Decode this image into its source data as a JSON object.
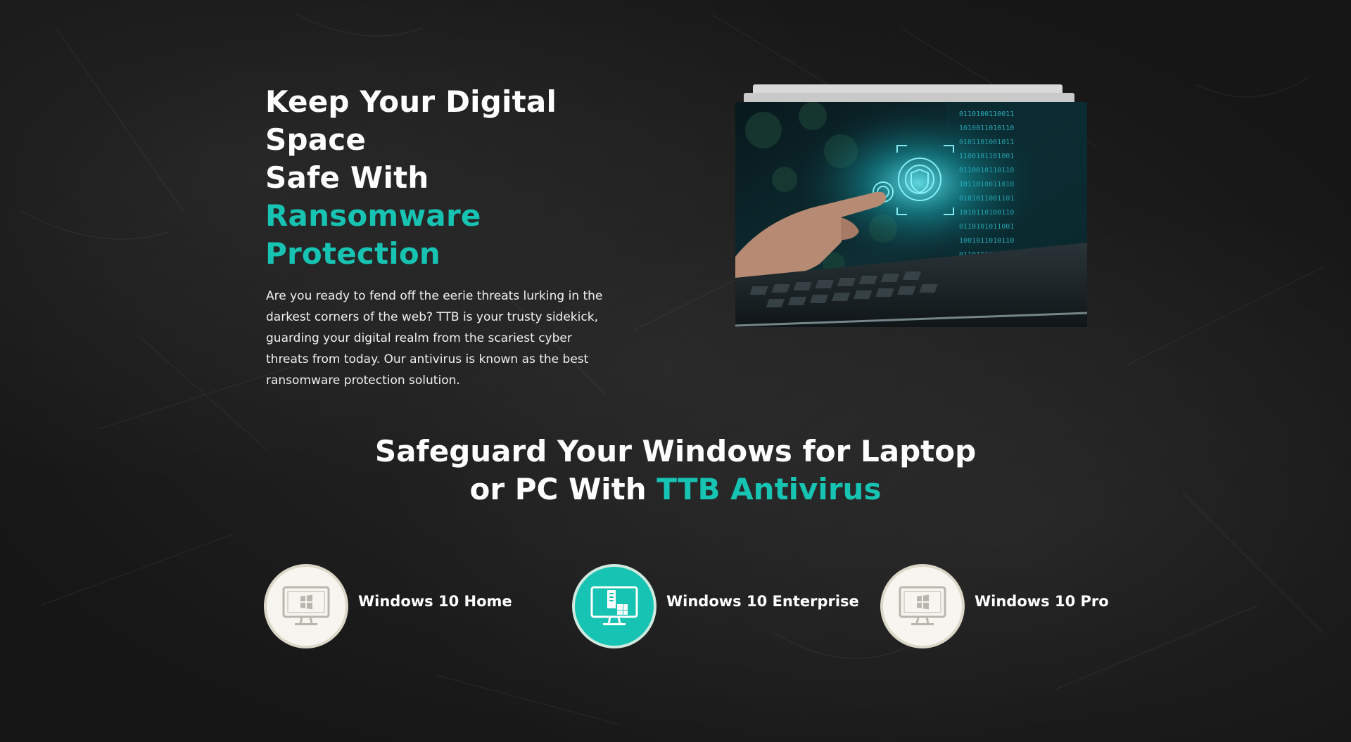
{
  "hero": {
    "title_line1": "Keep Your Digital Space",
    "title_line2_prefix": "Safe With ",
    "title_accent": "Ransomware Protection",
    "description": "Are you ready to fend off the eerie threats lurking in the darkest corners of the web? TTB is your trusty sidekick, guarding your digital realm from the scariest cyber threats from today. Our antivirus is known as the best ransomware protection solution.",
    "image_alt": ""
  },
  "section": {
    "title_line1": "Safeguard Your Windows for Laptop",
    "title_line2_prefix": "or PC With ",
    "title_accent": "TTB Antivirus"
  },
  "editions": [
    {
      "label": "Windows 10 Home",
      "icon": "windows-monitor-icon",
      "active": false
    },
    {
      "label": "Windows 10 Enterprise",
      "icon": "enterprise-monitor-icon",
      "active": true
    },
    {
      "label": "Windows 10 Pro",
      "icon": "windows-monitor-icon",
      "active": false
    }
  ],
  "colors": {
    "accent": "#17c3b2",
    "background": "#1b1b1b",
    "text": "#ffffff",
    "icon_circle": "#f7f5ef",
    "icon_ring": "#dcd8c9"
  }
}
